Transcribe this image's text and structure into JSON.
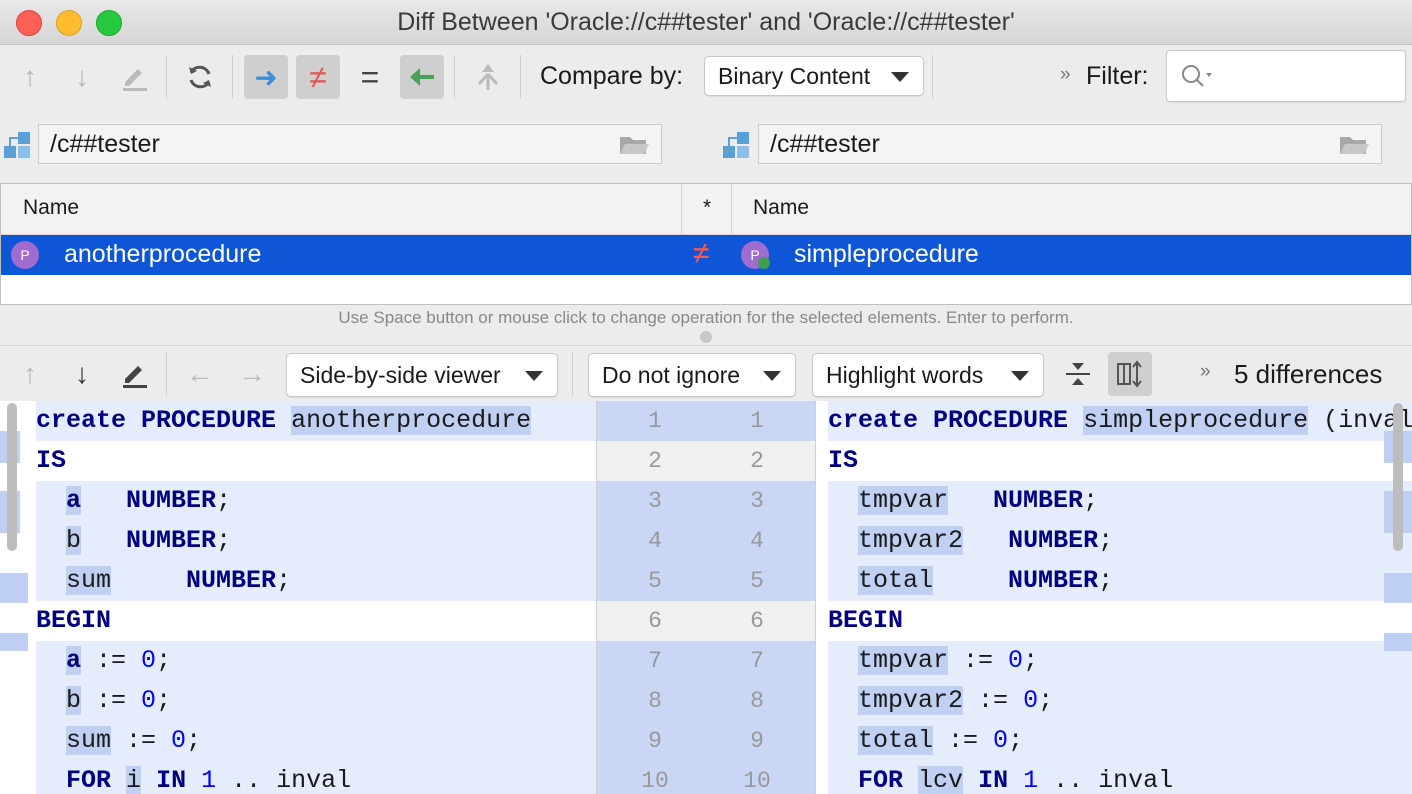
{
  "window": {
    "title": "Diff Between 'Oracle://c##tester' and 'Oracle://c##tester'"
  },
  "toolbar": {
    "compare_by_label": "Compare by:",
    "compare_by_value": "Binary Content",
    "filter_label": "Filter:",
    "more": "»"
  },
  "paths": {
    "left": "/c##tester",
    "right": "/c##tester"
  },
  "table": {
    "headers": {
      "left_name": "Name",
      "op": "*",
      "right_name": "Name"
    },
    "row": {
      "left": "anotherprocedure",
      "right": "simpleprocedure",
      "left_icon_letter": "P",
      "right_icon_letter": "P"
    }
  },
  "hint": "Use Space button or mouse click to change operation for the selected elements. Enter to perform.",
  "diff_toolbar": {
    "viewer": "Side-by-side viewer",
    "ignore": "Do not ignore",
    "highlight": "Highlight words",
    "more": "»",
    "differences": "5 differences"
  },
  "line_numbers": {
    "left": [
      "1",
      "2",
      "3",
      "4",
      "5",
      "6",
      "7",
      "8",
      "9",
      "10"
    ],
    "right": [
      "1",
      "2",
      "3",
      "4",
      "5",
      "6",
      "7",
      "8",
      "9",
      "10"
    ]
  },
  "colors": {
    "selection": "#0f55d8",
    "changed_bg": "#e5ecfb",
    "word_highlight": "#c0d0f2",
    "keyword": "#000080",
    "number": "#0000ff"
  }
}
